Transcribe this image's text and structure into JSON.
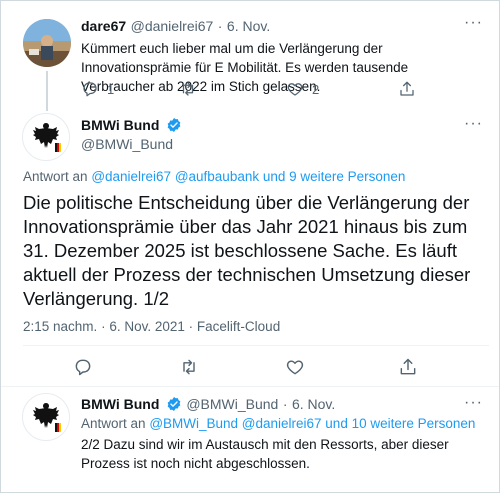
{
  "tweet1": {
    "name": "dare67",
    "handle": "@danielrei67",
    "sep": "·",
    "date": "6. Nov.",
    "text": "Kümmert euch lieber mal um die Verlängerung der Innovationsprämie für E Mobilität. Es werden tausende Verbraucher ab 2022 im Stich gelassen.",
    "reply_count": "1",
    "like_count": "2"
  },
  "main_tweet": {
    "name": "BMWi Bund",
    "handle": "@BMWi_Bund",
    "reply_prefix": "Antwort an",
    "reply_handles": "@danielrei67 @aufbaubank und 9 weitere Personen",
    "text": "Die politische Entscheidung über die Verlängerung der Innovationsprämie über das Jahr 2021 hinaus bis zum 31. Dezember 2025 ist beschlossene Sache. Es läuft aktuell der Prozess der technischen Umsetzung dieser Verlängerung. 1/2",
    "time": "2:15 nachm.",
    "sep": "·",
    "date": "6. Nov. 2021",
    "source": "Facelift-Cloud"
  },
  "tweet3": {
    "name": "BMWi Bund",
    "handle": "@BMWi_Bund",
    "sep": "·",
    "date": "6. Nov.",
    "reply_prefix": "Antwort an",
    "reply_handles": "@BMWi_Bund @danielrei67 und 10 weitere Personen",
    "text": "2/2 Dazu sind wir im Austausch mit den Ressorts, aber dieser Prozess ist noch nicht abgeschlossen."
  },
  "more_label": "···",
  "colors": {
    "accent": "#1d9bf0",
    "muted": "#536471",
    "border": "#cfd9de"
  },
  "icons": [
    "reply-icon",
    "retweet-icon",
    "like-icon",
    "share-icon",
    "verified-icon",
    "eagle-icon",
    "more-icon"
  ]
}
